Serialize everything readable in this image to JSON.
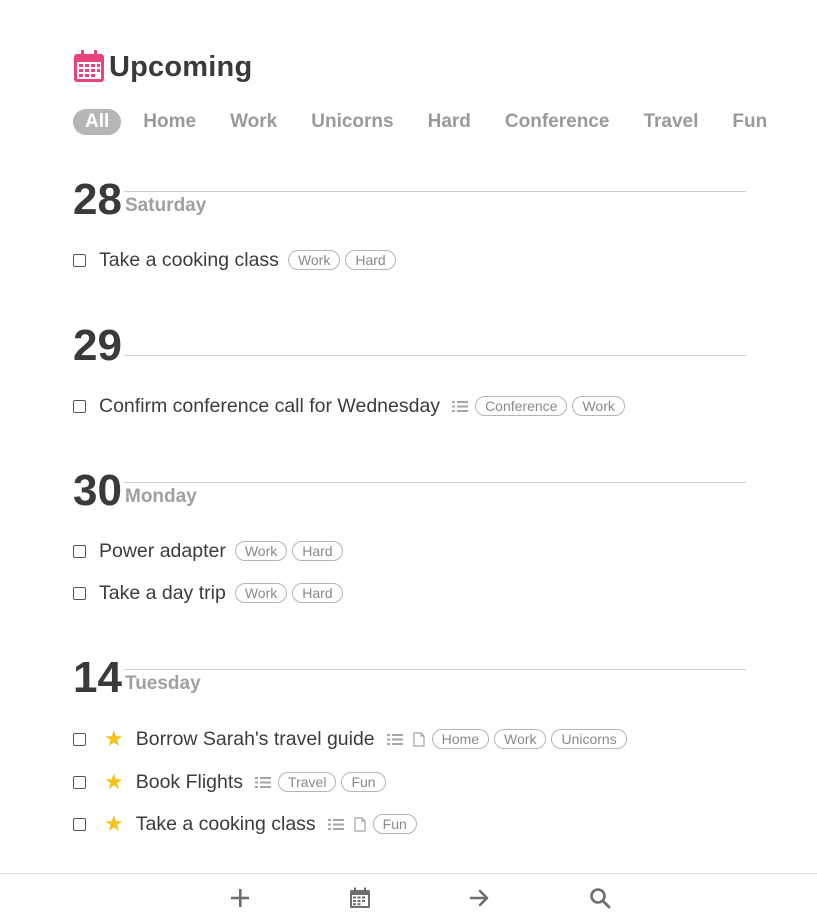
{
  "header": {
    "title": "Upcoming",
    "icon": "calendar-icon",
    "icon_color": "#e8437a"
  },
  "tabs": [
    "All",
    "Home",
    "Work",
    "Unicorns",
    "Hard",
    "Conference",
    "Travel",
    "Fun"
  ],
  "active_tab": "All",
  "days": [
    {
      "number": "28",
      "name": "Saturday",
      "tasks": [
        {
          "title": "Take a cooking class",
          "tags": [
            "Work",
            "Hard"
          ]
        }
      ]
    },
    {
      "number": "29",
      "name": "",
      "tasks": [
        {
          "title": "Confirm conference call for Wednesday",
          "has_list": true,
          "tags": [
            "Conference",
            "Work"
          ]
        }
      ]
    },
    {
      "number": "30",
      "name": "Monday",
      "tasks": [
        {
          "title": "Power adapter",
          "tags": [
            "Work",
            "Hard"
          ]
        },
        {
          "title": "Take a day trip",
          "tags": [
            "Work",
            "Hard"
          ]
        }
      ]
    },
    {
      "number": "14",
      "name": "Tuesday",
      "tasks": [
        {
          "title": "Borrow Sarah's travel guide",
          "starred": true,
          "has_list": true,
          "has_note": true,
          "tags": [
            "Home",
            "Work",
            "Unicorns"
          ]
        },
        {
          "title": "Book Flights",
          "starred": true,
          "has_list": true,
          "tags": [
            "Travel",
            "Fun"
          ]
        },
        {
          "title": "Take a cooking class",
          "starred": true,
          "has_list": true,
          "has_note": true,
          "tags": [
            "Fun"
          ]
        }
      ]
    }
  ],
  "toolbar": {
    "icons": [
      "plus-icon",
      "calendar-icon",
      "arrow-right-icon",
      "search-icon"
    ]
  },
  "colors": {
    "star": "#f7c21b",
    "accent": "#e8437a",
    "active_tab_bg": "#b6b6b6"
  }
}
